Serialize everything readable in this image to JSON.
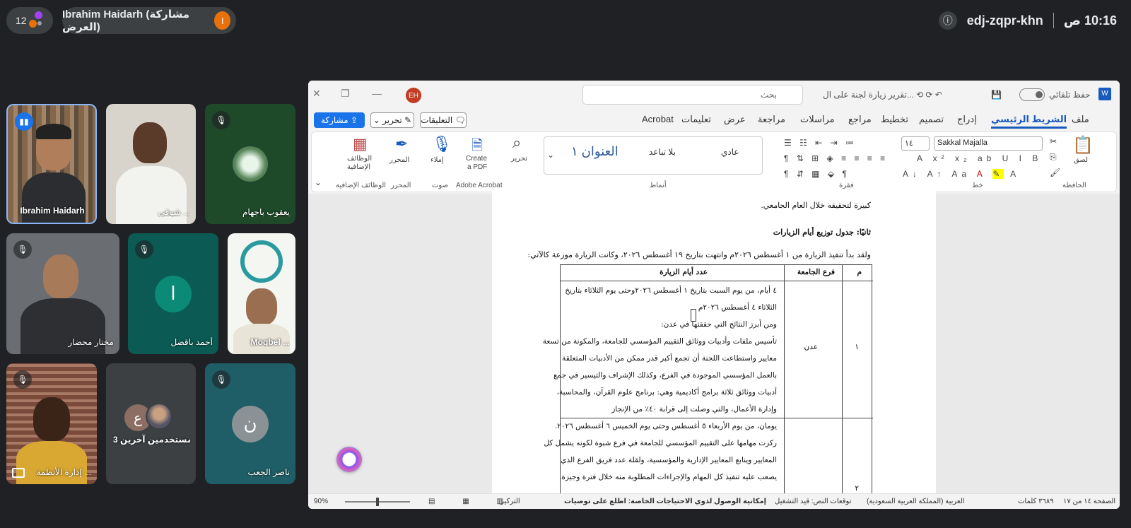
{
  "meet": {
    "participant_count": "12",
    "presenter_label": "Ibrahim Haidarh (مشاركة العرض)",
    "presenter_initial": "I",
    "meeting_code": "edj-zqpr-khn",
    "clock": "10:16 ص",
    "info_icon": "info-icon"
  },
  "tiles": [
    {
      "name": "Ibrahim Haidarh",
      "muted": false,
      "active": true
    },
    {
      "name": "شوقي ...",
      "muted": false
    },
    {
      "name": "يعقوب باجهام",
      "muted": true
    },
    {
      "name": "مختار محضار",
      "muted": true
    },
    {
      "name": "أحمد باقضل",
      "muted": true,
      "initial": "ا",
      "color": "#0b8a78"
    },
    {
      "name": "Moqbel ...",
      "muted": false
    },
    {
      "name": "إدارة الأنظمة ...",
      "muted": true
    },
    {
      "name": "3 مستخدمين آخرين",
      "initial": "ع"
    },
    {
      "name": "ناصر الجعب",
      "muted": true,
      "initial": "ن",
      "color": "#8a9295"
    }
  ],
  "word": {
    "autosave_label": "حفظ تلقائي",
    "doc_title": "تقرير زيارة لجنة على ال...",
    "search_placeholder": "بحث",
    "user_initials": "EH",
    "tabs": [
      "ملف",
      "الشريط الرئيسي",
      "إدراج",
      "تصميم",
      "تخطيط",
      "مراجع",
      "مراسلات",
      "مراجعة",
      "عرض",
      "تعليمات",
      "Acrobat"
    ],
    "share_label": "مشاركة",
    "edit_label": "تحرير",
    "comments_label": "التعليقات",
    "font_name": "Sakkal Majalla",
    "font_size": "١٤",
    "styles": [
      "عادي",
      "بلا تباعد",
      "العنوان ١"
    ],
    "groups": {
      "clipboard": "الحافظة",
      "font": "خط",
      "paragraph": "فقرة",
      "styles": "أنماط",
      "adobe": "Adobe Acrobat",
      "voice": "صوت",
      "editor": "المحرر",
      "addins": "الوظائف الإضافية"
    },
    "buttons": {
      "paste": "لصق",
      "editing": "تحرير",
      "create_pdf_line1": "Create",
      "create_pdf_line2": "a PDF",
      "dictate": "إملاء",
      "editor": "المحرر",
      "addins_line1": "الوظائف",
      "addins_line2": "الإضافية"
    },
    "doc": {
      "line_top": "كبيرة لتحقيقه خلال العام الجامعي.",
      "heading": "ثانيًا: جدول توزيع أيام الزيارات",
      "intro": "ولقد بدأ تنفيذ الزيارة من ١ أغسطس ٢٠٢٦م وانتهت بتاريخ ١٩ أغسطس ٢٠٢٦، وكانت الزيارة موزعة كالآتي:",
      "col_m": "م",
      "col_branch": "فرع الجامعة",
      "col_days": "عدد أيام الزيارة",
      "row1_num": "١",
      "row1_branch": "عدن",
      "row1_lines": [
        "٤ أيام، من يوم السبت بتاريخ ١ أغسطس ٢٠٢٦وحتى يوم الثلاثاء بتاريخ",
        "الثلاثاء ٤ أغسطس ٢٠٢٦م",
        "ومن أبرز النتائج التي حققتها في عدن:",
        "تأسيس ملفات وأدبيات ووثائق التقييم المؤسسي للجامعة، والمكونة من تسعة",
        "معايير واستطاعت اللجنة أن تجمع أكبر قدر ممكن من الأدبيات المتعلقة",
        "بالعمل المؤسسي الموجودة في الفرع، وكذلك الإشراف والتيسير في جمع",
        "أدبيات ووثائق ثلاثة برامج أكاديمية وهي: برنامج علوم القرآن، والمحاسبة،",
        "وإدارة الأعمال، والتي وصلت إلى قرابة ٤٠٪ من الإنجاز"
      ],
      "row2_num": "٢",
      "row2_lines": [
        "يومان، من يوم الأربعاء ٥ أغسطس وحتى يوم الخميس ٦ أغسطس ٢٠٢٦.",
        "ركزت مهامها على التقييم المؤسسي للجامعة في فرع شبوة لكونه يشمل كل",
        "المعايير وينابع المعايير الإدارية والمؤسسية، ولقلة عدد فريق الفرع الذي",
        "يصعب عليه تنفيذ كل المهام والإجراءات المطلوبة منه خلال فترة وجيزة."
      ]
    },
    "status": {
      "page": "الصفحة ١٤ من ١٧",
      "words": "٣٦٨٩ كلمات",
      "language": "العربية (المملكة العربية السعودية)",
      "predictions": "توقعات النص: قيد التشغيل",
      "accessibility": "إمكانية الوصول لذوي الاحتياجات الخاصة: اطلع على توصيات",
      "focus": "التركيز",
      "zoom": "90%"
    }
  }
}
